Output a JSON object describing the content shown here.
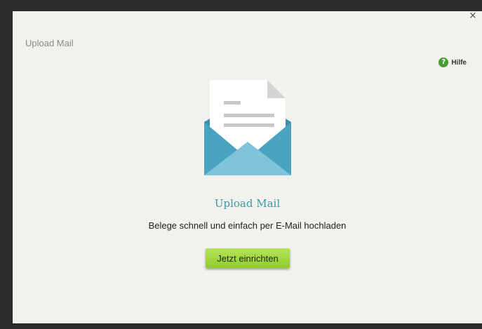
{
  "dialog": {
    "title": "Upload Mail",
    "close_label": "×",
    "help": {
      "icon": "question-icon",
      "icon_glyph": "?",
      "label": "Hilfe",
      "color": "#4a9a36"
    }
  },
  "feature": {
    "illustration": "envelope-letter-icon",
    "title": "Upload Mail",
    "description": "Belege schnell und einfach per E-Mail hochladen",
    "button_label": "Jetzt einrichten"
  },
  "colors": {
    "accent_title": "#3a9aa0",
    "button_green": "#9ad63a",
    "envelope_blue": "#4aa3c0",
    "background": "#f3f1ee"
  }
}
